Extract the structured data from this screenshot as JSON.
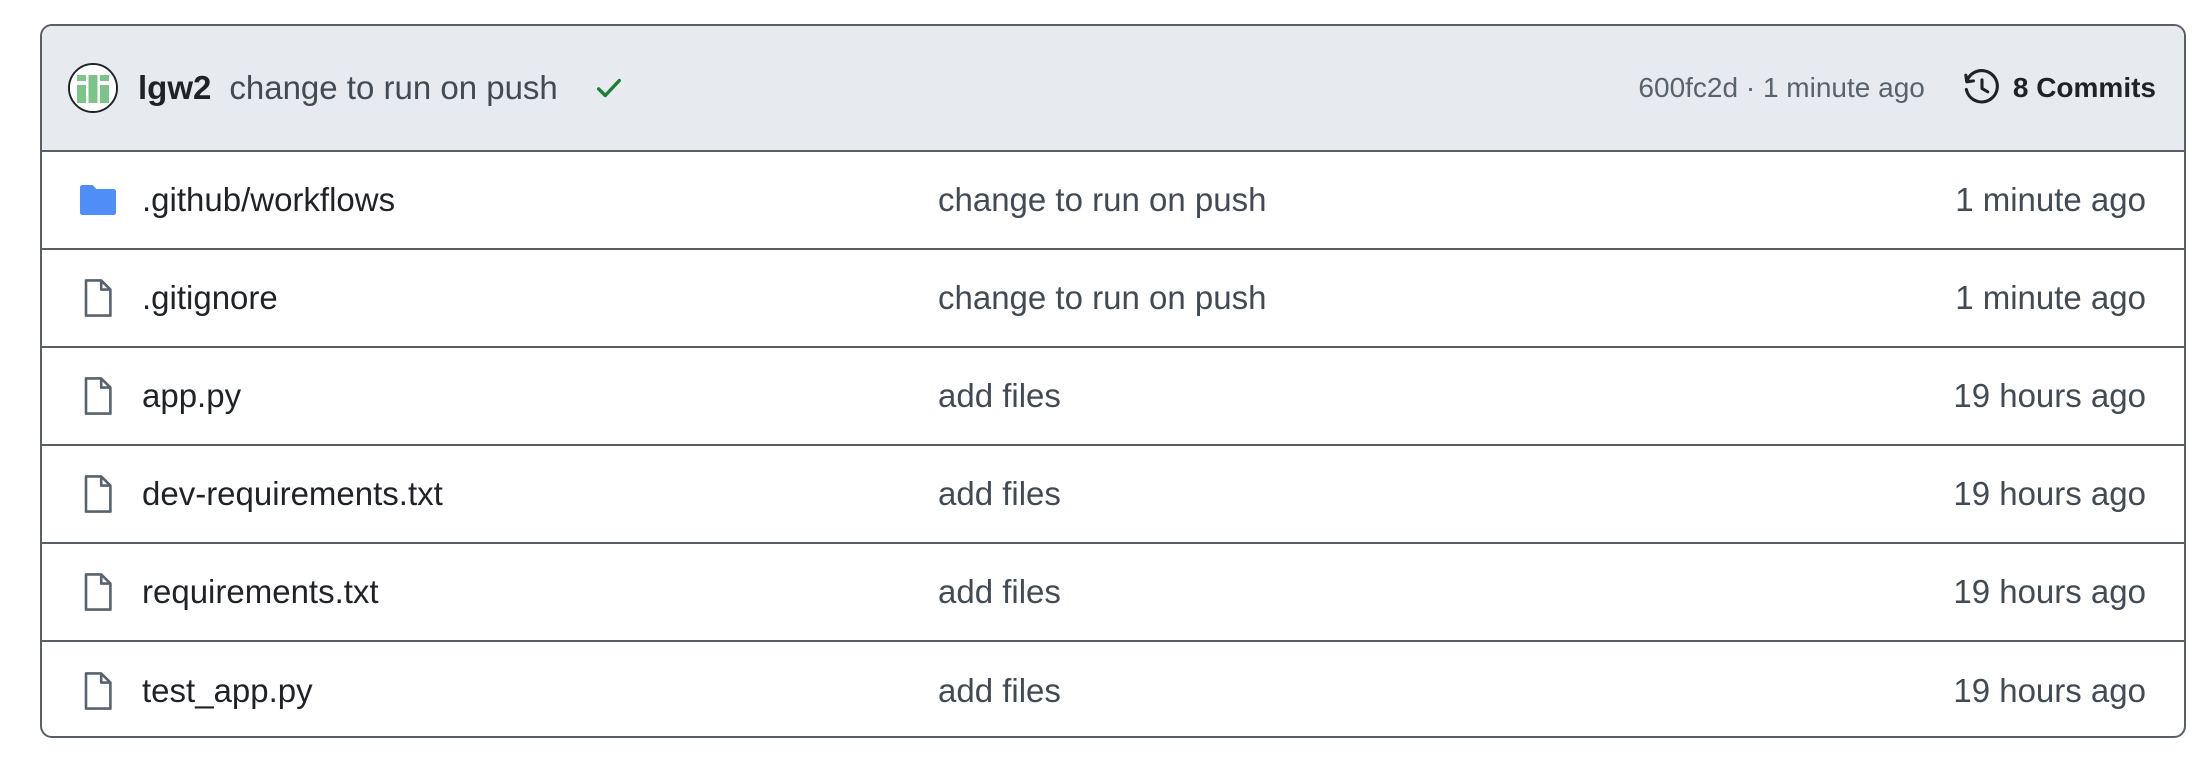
{
  "commit": {
    "author": "lgw2",
    "message": "change to run on push",
    "status_icon": "check-icon",
    "hash": "600fc2d",
    "separator": " · ",
    "time": "1 minute ago",
    "history_icon": "history-icon",
    "commits_label": "8 Commits"
  },
  "files": [
    {
      "icon": "folder-icon",
      "name": ".github/workflows",
      "message": "change to run on push",
      "time": "1 minute ago"
    },
    {
      "icon": "file-icon",
      "name": ".gitignore",
      "message": "change to run on push",
      "time": "1 minute ago"
    },
    {
      "icon": "file-icon",
      "name": "app.py",
      "message": "add files",
      "time": "19 hours ago"
    },
    {
      "icon": "file-icon",
      "name": "dev-requirements.txt",
      "message": "add files",
      "time": "19 hours ago"
    },
    {
      "icon": "file-icon",
      "name": "requirements.txt",
      "message": "add files",
      "time": "19 hours ago"
    },
    {
      "icon": "file-icon",
      "name": "test_app.py",
      "message": "add files",
      "time": "19 hours ago"
    }
  ],
  "colors": {
    "folder": "#4f8ef7",
    "check": "#1a7f37",
    "header_bg": "#e7eaee",
    "avatar_green": "#7cc48a"
  }
}
